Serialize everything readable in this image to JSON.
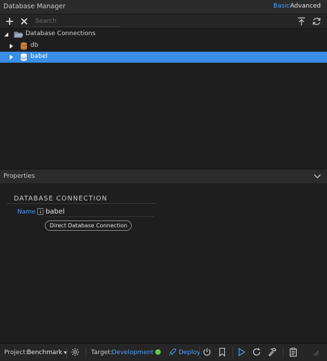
{
  "window": {
    "title": "Database Manager",
    "modes": [
      "Basic",
      "Advanced"
    ],
    "active_mode": "Basic"
  },
  "toolbar": {
    "search_placeholder": "Search"
  },
  "tree": {
    "root": {
      "label": "Database Connections",
      "icon": "folder-icon"
    },
    "items": [
      {
        "label": "db",
        "icon": "database-icon",
        "color": "#d4883a",
        "selected": false
      },
      {
        "label": "babel",
        "icon": "database-icon",
        "color": "#ffffff",
        "selected": true
      }
    ]
  },
  "properties": {
    "header": "Properties",
    "section": "DATABASE CONNECTION",
    "name_label": "Name",
    "name_value": "babel",
    "connection_type": "Direct Database Connection"
  },
  "statusbar": {
    "project_label": "Project:",
    "project_value": "Benchmark",
    "target_label": "Target:",
    "target_value": "Development",
    "target_status_color": "#6cc644",
    "deploy_label": "Deploy"
  },
  "colors": {
    "accent": "#4a9eff",
    "selection": "#3a8ee6",
    "background": "#1e1e1e"
  }
}
